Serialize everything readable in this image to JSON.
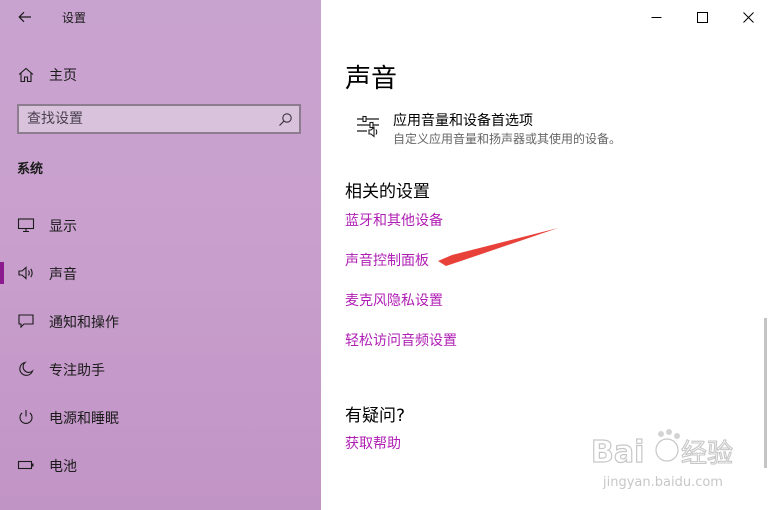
{
  "window": {
    "title": "设置",
    "controls": {
      "minimize": "minimize",
      "maximize": "maximize",
      "close": "close"
    }
  },
  "sidebar": {
    "home_label": "主页",
    "search_placeholder": "查找设置",
    "section_label": "系统",
    "items": [
      {
        "label": "显示",
        "icon": "monitor-icon",
        "active": false
      },
      {
        "label": "声音",
        "icon": "speaker-icon",
        "active": true
      },
      {
        "label": "通知和操作",
        "icon": "notification-icon",
        "active": false
      },
      {
        "label": "专注助手",
        "icon": "moon-icon",
        "active": false
      },
      {
        "label": "电源和睡眠",
        "icon": "power-icon",
        "active": false
      },
      {
        "label": "电池",
        "icon": "battery-icon",
        "active": false
      }
    ]
  },
  "main": {
    "title": "声音",
    "app_preferences": {
      "title": "应用音量和设备首选项",
      "description": "自定义应用音量和扬声器或其使用的设备。"
    },
    "related_settings": {
      "heading": "相关的设置",
      "links": [
        "蓝牙和其他设备",
        "声音控制面板",
        "麦克风隐私设置",
        "轻松访问音频设置"
      ]
    },
    "help": {
      "heading": "有疑问?",
      "link": "获取帮助"
    }
  },
  "watermark": {
    "brand": "Bai",
    "brand_cn": "经验",
    "url": "jingyan.baidu.com"
  },
  "colors": {
    "sidebar_top": "#c9a3d0",
    "sidebar_bottom": "#c194c6",
    "accent": "#8a1a8e",
    "link": "#b01fb5",
    "annotation_arrow": "#e8413a"
  }
}
